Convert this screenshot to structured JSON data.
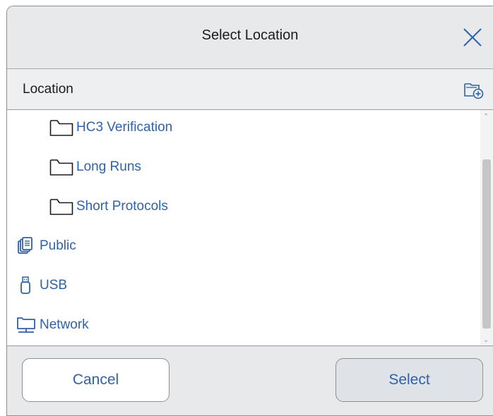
{
  "dialog": {
    "title": "Select Location",
    "location_label": "Location",
    "items": [
      {
        "label": "HC3 Verification",
        "icon": "folder-icon",
        "level": 1
      },
      {
        "label": "Long Runs",
        "icon": "folder-icon",
        "level": 1
      },
      {
        "label": "Short Protocols",
        "icon": "folder-icon",
        "level": 1
      },
      {
        "label": "Public",
        "icon": "public-icon",
        "level": 0
      },
      {
        "label": "USB",
        "icon": "usb-icon",
        "level": 0
      },
      {
        "label": "Network",
        "icon": "network-icon",
        "level": 0
      }
    ],
    "cancel_label": "Cancel",
    "select_label": "Select"
  },
  "colors": {
    "accent_text": "#2f62a8",
    "titlebar_bg": "#e8e9eb"
  }
}
